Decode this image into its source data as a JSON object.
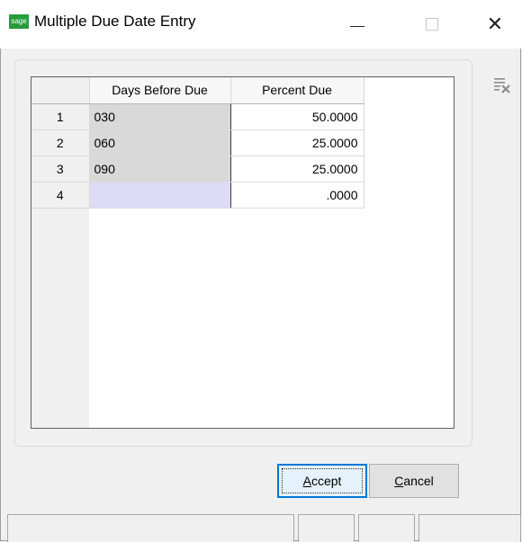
{
  "window": {
    "title": "Multiple Due Date Entry",
    "app_icon_text": "sage",
    "close_glyph": "✕"
  },
  "grid": {
    "headers": [
      "",
      "Days Before Due",
      "Percent Due"
    ],
    "rows": [
      {
        "num": "1",
        "days": "030",
        "percent": "50.0000"
      },
      {
        "num": "2",
        "days": "060",
        "percent": "25.0000"
      },
      {
        "num": "3",
        "days": "090",
        "percent": "25.0000"
      },
      {
        "num": "4",
        "days": "",
        "percent": ".0000"
      }
    ]
  },
  "buttons": {
    "accept": {
      "hotkey": "A",
      "rest": "ccept"
    },
    "cancel": {
      "hotkey": "C",
      "rest": "ancel"
    }
  },
  "icons": {
    "delete_line": "delete-line-icon"
  },
  "colors": {
    "accent": "#0078d7",
    "sage_green": "#2a9b3b",
    "locked_cell": "#d9d9d9",
    "active_cell": "#dcdcf7"
  }
}
